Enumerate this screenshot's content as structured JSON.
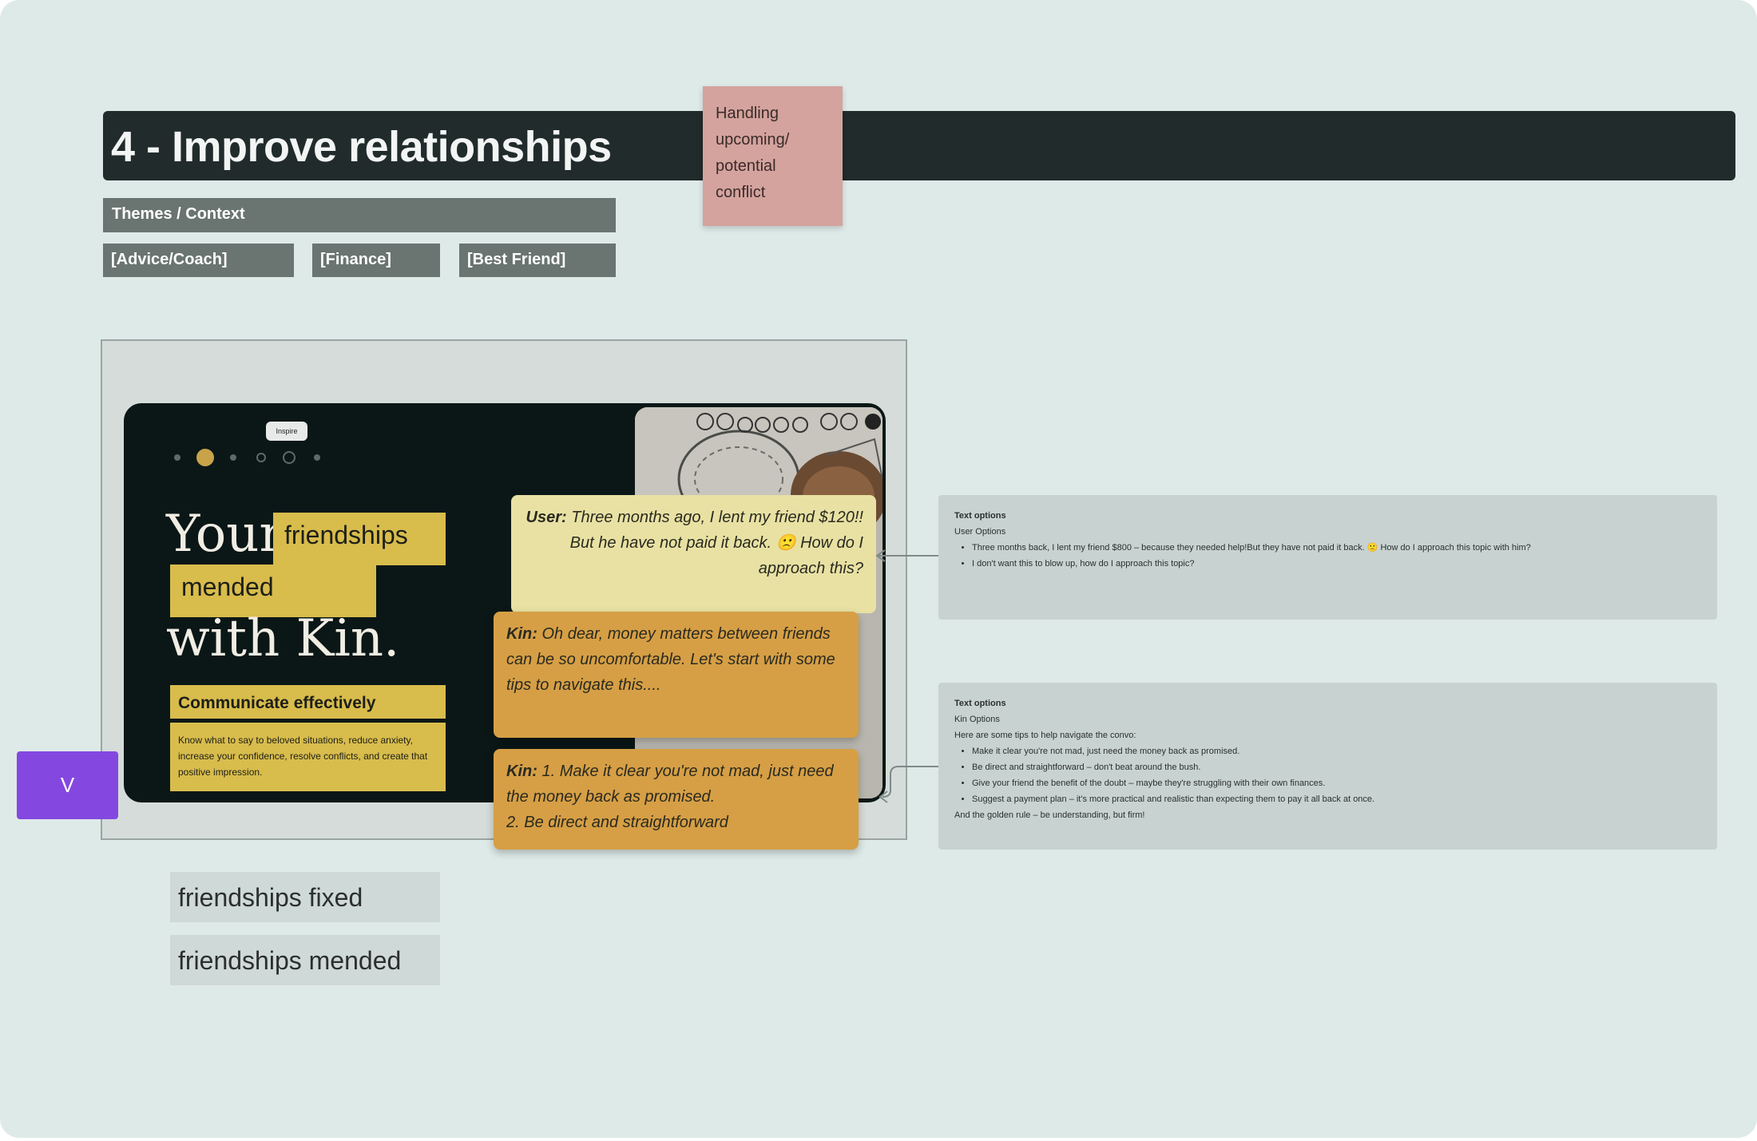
{
  "title": "4 - Improve relationships",
  "sticky_note": "Handling upcoming/ potential conflict",
  "themes_label": "Themes / Context",
  "tags": [
    "[Advice/Coach]",
    "[Finance]",
    "[Best Friend]"
  ],
  "preview": {
    "hero_your": "Your",
    "hero_highlight_1": "friendships",
    "hero_highlight_2": "mended",
    "hero_with_kin": "with Kin.",
    "feature_title": "Communicate effectively",
    "feature_body": "Know what to say to beloved situations, reduce anxiety, increase your confidence, resolve conflicts, and create that positive impression.",
    "tooltip": "Inspire"
  },
  "chat": {
    "user_label": "User:",
    "user_text": "Three months ago, I lent my friend $120!! But he have not paid it back. 🙁 How do I approach this?",
    "kin1_label": "Kin:",
    "kin1_text": "Oh dear, money matters between friends can be so uncomfortable. Let's start with some tips to navigate this....",
    "kin2_label": "Kin:",
    "kin2_line1": "1. Make it clear you're not mad, just need the money back as promised.",
    "kin2_line2": "2. Be direct and straightforward"
  },
  "text_options_1": {
    "heading": "Text options",
    "sub": "User Options",
    "items": [
      "Three months back, I lent my friend $800 – because they needed help!But they have not paid it back. 🙁 How do I approach this topic with him?",
      "I don't want this to blow up, how do I approach this topic?"
    ]
  },
  "text_options_2": {
    "heading": "Text options",
    "sub": "Kin Options",
    "intro": "Here are some tips to help navigate the convo:",
    "items": [
      "Make it clear you're not mad, just need the money back as promised.",
      "Be direct and straightforward – don't beat around the bush.",
      "Give your friend the benefit of the doubt – maybe they're struggling with their own finances.",
      "Suggest a payment plan – it's more practical and realistic than expecting them to pay it all back at once."
    ],
    "outro": "And the golden rule – be understanding, but firm!"
  },
  "purple_button": "V",
  "labels": [
    "friendships fixed",
    "friendships mended"
  ],
  "colors": {
    "canvas": "#deeae8",
    "title_bar": "#212b2b",
    "sticky": "#d4a39e",
    "tag": "#6a7471",
    "highlight": "#d8bc4c",
    "kin_bubble": "#d69f45",
    "user_bubble": "#e8e1a3",
    "purple": "#8448e0"
  }
}
